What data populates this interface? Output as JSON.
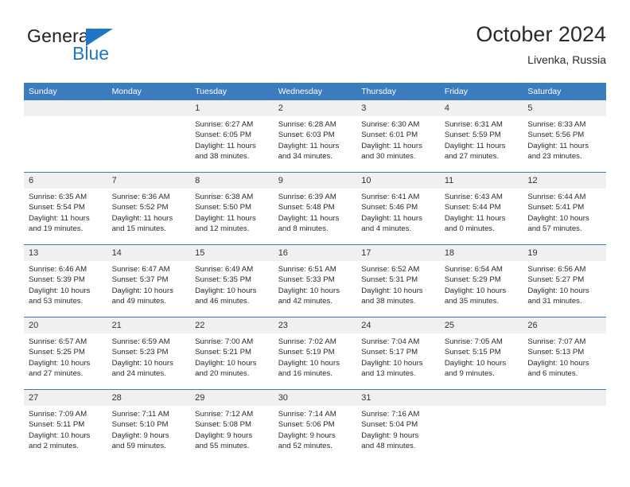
{
  "brand": {
    "name_top": "General",
    "name_bottom": "Blue",
    "triangle_color": "#1f77c2"
  },
  "header": {
    "title": "October 2024",
    "subtitle": "Livenka, Russia"
  },
  "theme": {
    "header_bg": "#3a7cbe",
    "header_text": "#ffffff",
    "daynum_bg": "#f0f0f0",
    "row_border": "#3a7cbe",
    "body_text": "#2b2b2b"
  },
  "weekdays": [
    "Sunday",
    "Monday",
    "Tuesday",
    "Wednesday",
    "Thursday",
    "Friday",
    "Saturday"
  ],
  "weeks": [
    [
      {
        "day": "",
        "lines": []
      },
      {
        "day": "",
        "lines": []
      },
      {
        "day": "1",
        "lines": [
          "Sunrise: 6:27 AM",
          "Sunset: 6:05 PM",
          "Daylight: 11 hours",
          "and 38 minutes."
        ]
      },
      {
        "day": "2",
        "lines": [
          "Sunrise: 6:28 AM",
          "Sunset: 6:03 PM",
          "Daylight: 11 hours",
          "and 34 minutes."
        ]
      },
      {
        "day": "3",
        "lines": [
          "Sunrise: 6:30 AM",
          "Sunset: 6:01 PM",
          "Daylight: 11 hours",
          "and 30 minutes."
        ]
      },
      {
        "day": "4",
        "lines": [
          "Sunrise: 6:31 AM",
          "Sunset: 5:59 PM",
          "Daylight: 11 hours",
          "and 27 minutes."
        ]
      },
      {
        "day": "5",
        "lines": [
          "Sunrise: 6:33 AM",
          "Sunset: 5:56 PM",
          "Daylight: 11 hours",
          "and 23 minutes."
        ]
      }
    ],
    [
      {
        "day": "6",
        "lines": [
          "Sunrise: 6:35 AM",
          "Sunset: 5:54 PM",
          "Daylight: 11 hours",
          "and 19 minutes."
        ]
      },
      {
        "day": "7",
        "lines": [
          "Sunrise: 6:36 AM",
          "Sunset: 5:52 PM",
          "Daylight: 11 hours",
          "and 15 minutes."
        ]
      },
      {
        "day": "8",
        "lines": [
          "Sunrise: 6:38 AM",
          "Sunset: 5:50 PM",
          "Daylight: 11 hours",
          "and 12 minutes."
        ]
      },
      {
        "day": "9",
        "lines": [
          "Sunrise: 6:39 AM",
          "Sunset: 5:48 PM",
          "Daylight: 11 hours",
          "and 8 minutes."
        ]
      },
      {
        "day": "10",
        "lines": [
          "Sunrise: 6:41 AM",
          "Sunset: 5:46 PM",
          "Daylight: 11 hours",
          "and 4 minutes."
        ]
      },
      {
        "day": "11",
        "lines": [
          "Sunrise: 6:43 AM",
          "Sunset: 5:44 PM",
          "Daylight: 11 hours",
          "and 0 minutes."
        ]
      },
      {
        "day": "12",
        "lines": [
          "Sunrise: 6:44 AM",
          "Sunset: 5:41 PM",
          "Daylight: 10 hours",
          "and 57 minutes."
        ]
      }
    ],
    [
      {
        "day": "13",
        "lines": [
          "Sunrise: 6:46 AM",
          "Sunset: 5:39 PM",
          "Daylight: 10 hours",
          "and 53 minutes."
        ]
      },
      {
        "day": "14",
        "lines": [
          "Sunrise: 6:47 AM",
          "Sunset: 5:37 PM",
          "Daylight: 10 hours",
          "and 49 minutes."
        ]
      },
      {
        "day": "15",
        "lines": [
          "Sunrise: 6:49 AM",
          "Sunset: 5:35 PM",
          "Daylight: 10 hours",
          "and 46 minutes."
        ]
      },
      {
        "day": "16",
        "lines": [
          "Sunrise: 6:51 AM",
          "Sunset: 5:33 PM",
          "Daylight: 10 hours",
          "and 42 minutes."
        ]
      },
      {
        "day": "17",
        "lines": [
          "Sunrise: 6:52 AM",
          "Sunset: 5:31 PM",
          "Daylight: 10 hours",
          "and 38 minutes."
        ]
      },
      {
        "day": "18",
        "lines": [
          "Sunrise: 6:54 AM",
          "Sunset: 5:29 PM",
          "Daylight: 10 hours",
          "and 35 minutes."
        ]
      },
      {
        "day": "19",
        "lines": [
          "Sunrise: 6:56 AM",
          "Sunset: 5:27 PM",
          "Daylight: 10 hours",
          "and 31 minutes."
        ]
      }
    ],
    [
      {
        "day": "20",
        "lines": [
          "Sunrise: 6:57 AM",
          "Sunset: 5:25 PM",
          "Daylight: 10 hours",
          "and 27 minutes."
        ]
      },
      {
        "day": "21",
        "lines": [
          "Sunrise: 6:59 AM",
          "Sunset: 5:23 PM",
          "Daylight: 10 hours",
          "and 24 minutes."
        ]
      },
      {
        "day": "22",
        "lines": [
          "Sunrise: 7:00 AM",
          "Sunset: 5:21 PM",
          "Daylight: 10 hours",
          "and 20 minutes."
        ]
      },
      {
        "day": "23",
        "lines": [
          "Sunrise: 7:02 AM",
          "Sunset: 5:19 PM",
          "Daylight: 10 hours",
          "and 16 minutes."
        ]
      },
      {
        "day": "24",
        "lines": [
          "Sunrise: 7:04 AM",
          "Sunset: 5:17 PM",
          "Daylight: 10 hours",
          "and 13 minutes."
        ]
      },
      {
        "day": "25",
        "lines": [
          "Sunrise: 7:05 AM",
          "Sunset: 5:15 PM",
          "Daylight: 10 hours",
          "and 9 minutes."
        ]
      },
      {
        "day": "26",
        "lines": [
          "Sunrise: 7:07 AM",
          "Sunset: 5:13 PM",
          "Daylight: 10 hours",
          "and 6 minutes."
        ]
      }
    ],
    [
      {
        "day": "27",
        "lines": [
          "Sunrise: 7:09 AM",
          "Sunset: 5:11 PM",
          "Daylight: 10 hours",
          "and 2 minutes."
        ]
      },
      {
        "day": "28",
        "lines": [
          "Sunrise: 7:11 AM",
          "Sunset: 5:10 PM",
          "Daylight: 9 hours",
          "and 59 minutes."
        ]
      },
      {
        "day": "29",
        "lines": [
          "Sunrise: 7:12 AM",
          "Sunset: 5:08 PM",
          "Daylight: 9 hours",
          "and 55 minutes."
        ]
      },
      {
        "day": "30",
        "lines": [
          "Sunrise: 7:14 AM",
          "Sunset: 5:06 PM",
          "Daylight: 9 hours",
          "and 52 minutes."
        ]
      },
      {
        "day": "31",
        "lines": [
          "Sunrise: 7:16 AM",
          "Sunset: 5:04 PM",
          "Daylight: 9 hours",
          "and 48 minutes."
        ]
      },
      {
        "day": "",
        "lines": []
      },
      {
        "day": "",
        "lines": []
      }
    ]
  ]
}
